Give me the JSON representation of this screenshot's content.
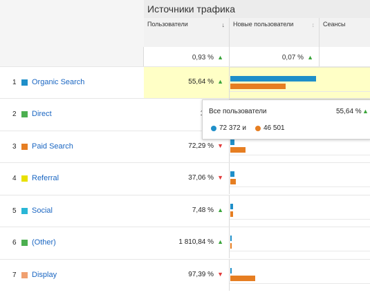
{
  "header": {
    "title": "Источники трафика"
  },
  "columns": {
    "users": {
      "label": "Пользователи",
      "sort_icon": "arrow-down"
    },
    "new_users": {
      "label": "Новые пользователи",
      "sort_icon": "sort-neutral"
    },
    "sessions": {
      "label": "Сеансы"
    }
  },
  "totals": {
    "users_pct": "0,93 %",
    "users_trend": "up",
    "new_users_pct": "0,07 %",
    "new_users_trend": "up"
  },
  "rows": [
    {
      "num": "1",
      "name": "Organic Search",
      "color": "#1f8fc9",
      "pct": "55,64 %",
      "trend": "up",
      "bar_blue": 0.62,
      "bar_orange": 0.4,
      "highlighted": true
    },
    {
      "num": "2",
      "name": "Direct",
      "color": "#4caf50",
      "pct": "15,4",
      "trend": "up",
      "bar_blue": 0.0,
      "bar_orange": 0.0,
      "highlighted": false
    },
    {
      "num": "3",
      "name": "Paid Search",
      "color": "#e67e22",
      "pct": "72,29 %",
      "trend": "down",
      "bar_blue": 0.03,
      "bar_orange": 0.11,
      "highlighted": false
    },
    {
      "num": "4",
      "name": "Referral",
      "color": "#e8e000",
      "pct": "37,06 %",
      "trend": "down",
      "bar_blue": 0.03,
      "bar_orange": 0.04,
      "highlighted": false
    },
    {
      "num": "5",
      "name": "Social",
      "color": "#29b6d6",
      "pct": "7,48 %",
      "trend": "up",
      "bar_blue": 0.02,
      "bar_orange": 0.02,
      "highlighted": false
    },
    {
      "num": "6",
      "name": "(Other)",
      "color": "#4caf50",
      "pct": "1 810,84 %",
      "trend": "up",
      "bar_blue": 0.005,
      "bar_orange": 0.005,
      "highlighted": false
    },
    {
      "num": "7",
      "name": "Display",
      "color": "#f0a070",
      "pct": "97,39 %",
      "trend": "down",
      "bar_blue": 0.005,
      "bar_orange": 0.18,
      "highlighted": false
    }
  ],
  "tooltip": {
    "title": "Все пользователи",
    "pct": "55,64 %",
    "trend": "up",
    "value1": "72 372 и",
    "value1_color": "#1f8fc9",
    "value2": "46 501",
    "value2_color": "#e67e22"
  }
}
